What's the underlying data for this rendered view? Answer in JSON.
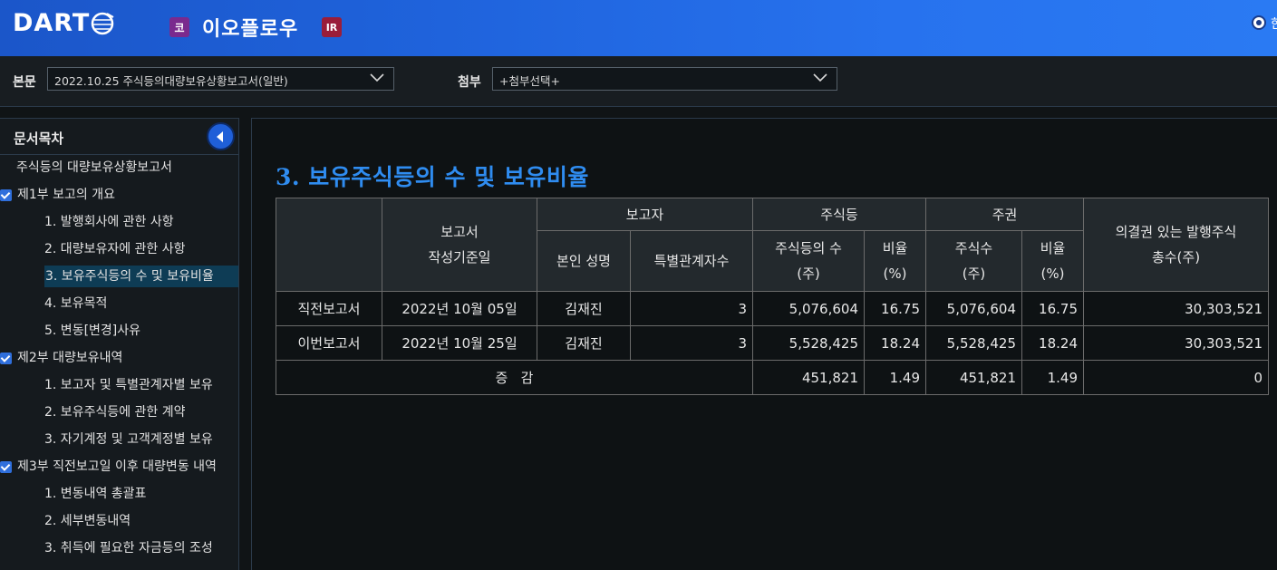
{
  "header": {
    "logo_text": "DART",
    "market_badge": "코",
    "company_name": "이오플로우",
    "ir_badge": "IR",
    "lang_label": "한"
  },
  "selbar": {
    "main_label": "본문",
    "main_value": "2022.10.25  주식등의대량보유상황보고서(일반)",
    "attach_label": "첨부",
    "attach_value": "+첨부선택+"
  },
  "toc": {
    "title": "문서목차",
    "items": [
      {
        "label": "주식등의 대량보유상황보고서",
        "level": 0,
        "check": false
      },
      {
        "label": "제1부 보고의 개요",
        "level": 0,
        "check": true
      },
      {
        "label": "1. 발행회사에 관한 사항",
        "level": 1,
        "check": false
      },
      {
        "label": "2. 대량보유자에 관한 사항",
        "level": 1,
        "check": false
      },
      {
        "label": "3. 보유주식등의 수 및 보유비율",
        "level": 1,
        "check": false,
        "active": true
      },
      {
        "label": "4. 보유목적",
        "level": 1,
        "check": false
      },
      {
        "label": "5. 변동[변경]사유",
        "level": 1,
        "check": false
      },
      {
        "label": "제2부 대량보유내역",
        "level": 0,
        "check": true
      },
      {
        "label": "1. 보고자 및 특별관계자별 보유",
        "level": 1,
        "check": false
      },
      {
        "label": "2. 보유주식등에 관한 계약",
        "level": 1,
        "check": false
      },
      {
        "label": "3. 자기계정 및 고객계정별 보유",
        "level": 1,
        "check": false
      },
      {
        "label": "제3부 직전보고일 이후 대량변동 내역",
        "level": 0,
        "check": true
      },
      {
        "label": "1. 변동내역 총괄표",
        "level": 1,
        "check": false
      },
      {
        "label": "2. 세부변동내역",
        "level": 1,
        "check": false
      },
      {
        "label": "3. 취득에 필요한 자금등의 조성",
        "level": 1,
        "check": false
      }
    ]
  },
  "section": {
    "title": "3. 보유주식등의 수 및 보유비율"
  },
  "table": {
    "h_basis_1": "보고서",
    "h_basis_2": "작성기준일",
    "h_reporter": "보고자",
    "h_name": "본인 성명",
    "h_related": "특별관계자수",
    "h_stocks": "주식등",
    "h_stock_count_1": "주식등의 수",
    "h_stock_count_2": "(주)",
    "h_ratio_1": "비율",
    "h_ratio_2": "(%)",
    "h_shares": "주권",
    "h_share_count_1": "주식수",
    "h_share_count_2": "(주)",
    "h_ratio2_1": "비율",
    "h_ratio2_2": "(%)",
    "h_total_1": "의결권 있는 발행주식",
    "h_total_2": "총수(주)",
    "rows": [
      {
        "type": "직전보고서",
        "date": "2022년 10월 05일",
        "name": "김재진",
        "related": "3",
        "stock_count": "5,076,604",
        "stock_ratio": "16.75",
        "share_count": "5,076,604",
        "share_ratio": "16.75",
        "total": "30,303,521"
      },
      {
        "type": "이번보고서",
        "date": "2022년 10월 25일",
        "name": "김재진",
        "related": "3",
        "stock_count": "5,528,425",
        "stock_ratio": "18.24",
        "share_count": "5,528,425",
        "share_ratio": "18.24",
        "total": "30,303,521"
      }
    ],
    "change": {
      "label": "증   감",
      "stock_count": "451,821",
      "stock_ratio": "1.49",
      "share_count": "451,821",
      "share_ratio": "1.49",
      "total": "0"
    }
  }
}
